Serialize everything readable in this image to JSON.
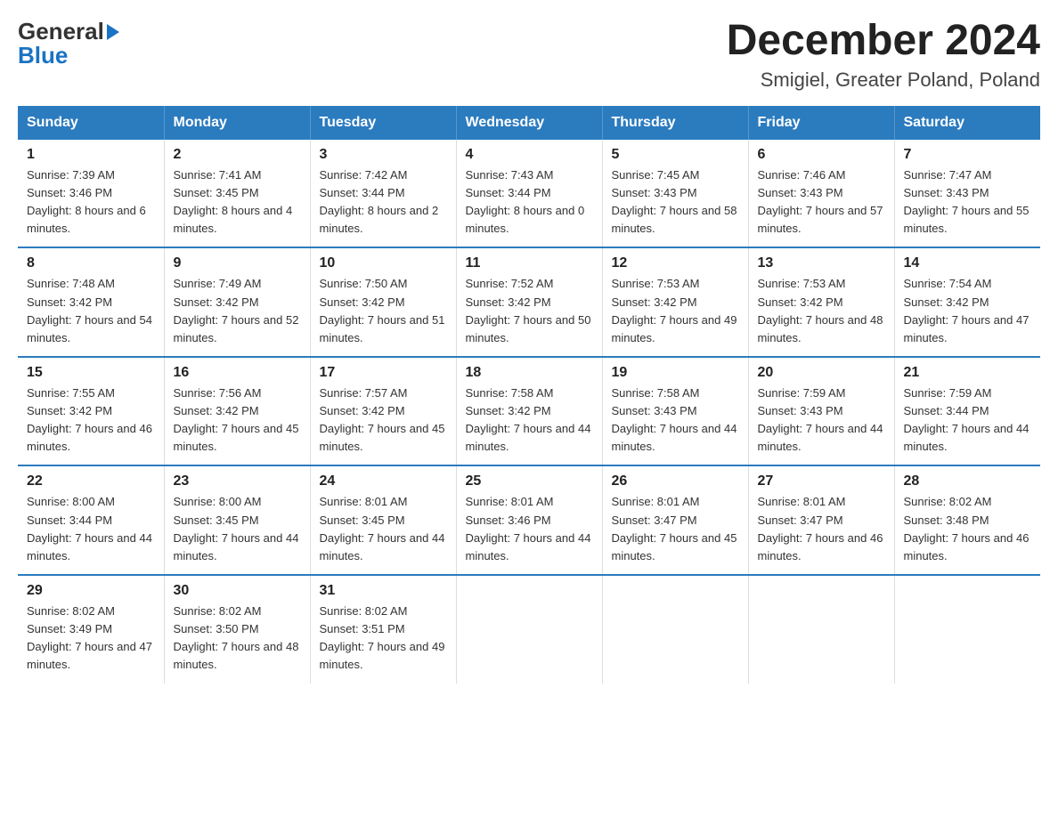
{
  "header": {
    "logo_line1": "General",
    "logo_line2": "Blue",
    "calendar_title": "December 2024",
    "calendar_subtitle": "Smigiel, Greater Poland, Poland"
  },
  "days_of_week": [
    "Sunday",
    "Monday",
    "Tuesday",
    "Wednesday",
    "Thursday",
    "Friday",
    "Saturday"
  ],
  "weeks": [
    [
      {
        "day": "1",
        "sunrise": "7:39 AM",
        "sunset": "3:46 PM",
        "daylight": "8 hours and 6 minutes."
      },
      {
        "day": "2",
        "sunrise": "7:41 AM",
        "sunset": "3:45 PM",
        "daylight": "8 hours and 4 minutes."
      },
      {
        "day": "3",
        "sunrise": "7:42 AM",
        "sunset": "3:44 PM",
        "daylight": "8 hours and 2 minutes."
      },
      {
        "day": "4",
        "sunrise": "7:43 AM",
        "sunset": "3:44 PM",
        "daylight": "8 hours and 0 minutes."
      },
      {
        "day": "5",
        "sunrise": "7:45 AM",
        "sunset": "3:43 PM",
        "daylight": "7 hours and 58 minutes."
      },
      {
        "day": "6",
        "sunrise": "7:46 AM",
        "sunset": "3:43 PM",
        "daylight": "7 hours and 57 minutes."
      },
      {
        "day": "7",
        "sunrise": "7:47 AM",
        "sunset": "3:43 PM",
        "daylight": "7 hours and 55 minutes."
      }
    ],
    [
      {
        "day": "8",
        "sunrise": "7:48 AM",
        "sunset": "3:42 PM",
        "daylight": "7 hours and 54 minutes."
      },
      {
        "day": "9",
        "sunrise": "7:49 AM",
        "sunset": "3:42 PM",
        "daylight": "7 hours and 52 minutes."
      },
      {
        "day": "10",
        "sunrise": "7:50 AM",
        "sunset": "3:42 PM",
        "daylight": "7 hours and 51 minutes."
      },
      {
        "day": "11",
        "sunrise": "7:52 AM",
        "sunset": "3:42 PM",
        "daylight": "7 hours and 50 minutes."
      },
      {
        "day": "12",
        "sunrise": "7:53 AM",
        "sunset": "3:42 PM",
        "daylight": "7 hours and 49 minutes."
      },
      {
        "day": "13",
        "sunrise": "7:53 AM",
        "sunset": "3:42 PM",
        "daylight": "7 hours and 48 minutes."
      },
      {
        "day": "14",
        "sunrise": "7:54 AM",
        "sunset": "3:42 PM",
        "daylight": "7 hours and 47 minutes."
      }
    ],
    [
      {
        "day": "15",
        "sunrise": "7:55 AM",
        "sunset": "3:42 PM",
        "daylight": "7 hours and 46 minutes."
      },
      {
        "day": "16",
        "sunrise": "7:56 AM",
        "sunset": "3:42 PM",
        "daylight": "7 hours and 45 minutes."
      },
      {
        "day": "17",
        "sunrise": "7:57 AM",
        "sunset": "3:42 PM",
        "daylight": "7 hours and 45 minutes."
      },
      {
        "day": "18",
        "sunrise": "7:58 AM",
        "sunset": "3:42 PM",
        "daylight": "7 hours and 44 minutes."
      },
      {
        "day": "19",
        "sunrise": "7:58 AM",
        "sunset": "3:43 PM",
        "daylight": "7 hours and 44 minutes."
      },
      {
        "day": "20",
        "sunrise": "7:59 AM",
        "sunset": "3:43 PM",
        "daylight": "7 hours and 44 minutes."
      },
      {
        "day": "21",
        "sunrise": "7:59 AM",
        "sunset": "3:44 PM",
        "daylight": "7 hours and 44 minutes."
      }
    ],
    [
      {
        "day": "22",
        "sunrise": "8:00 AM",
        "sunset": "3:44 PM",
        "daylight": "7 hours and 44 minutes."
      },
      {
        "day": "23",
        "sunrise": "8:00 AM",
        "sunset": "3:45 PM",
        "daylight": "7 hours and 44 minutes."
      },
      {
        "day": "24",
        "sunrise": "8:01 AM",
        "sunset": "3:45 PM",
        "daylight": "7 hours and 44 minutes."
      },
      {
        "day": "25",
        "sunrise": "8:01 AM",
        "sunset": "3:46 PM",
        "daylight": "7 hours and 44 minutes."
      },
      {
        "day": "26",
        "sunrise": "8:01 AM",
        "sunset": "3:47 PM",
        "daylight": "7 hours and 45 minutes."
      },
      {
        "day": "27",
        "sunrise": "8:01 AM",
        "sunset": "3:47 PM",
        "daylight": "7 hours and 46 minutes."
      },
      {
        "day": "28",
        "sunrise": "8:02 AM",
        "sunset": "3:48 PM",
        "daylight": "7 hours and 46 minutes."
      }
    ],
    [
      {
        "day": "29",
        "sunrise": "8:02 AM",
        "sunset": "3:49 PM",
        "daylight": "7 hours and 47 minutes."
      },
      {
        "day": "30",
        "sunrise": "8:02 AM",
        "sunset": "3:50 PM",
        "daylight": "7 hours and 48 minutes."
      },
      {
        "day": "31",
        "sunrise": "8:02 AM",
        "sunset": "3:51 PM",
        "daylight": "7 hours and 49 minutes."
      },
      null,
      null,
      null,
      null
    ]
  ]
}
